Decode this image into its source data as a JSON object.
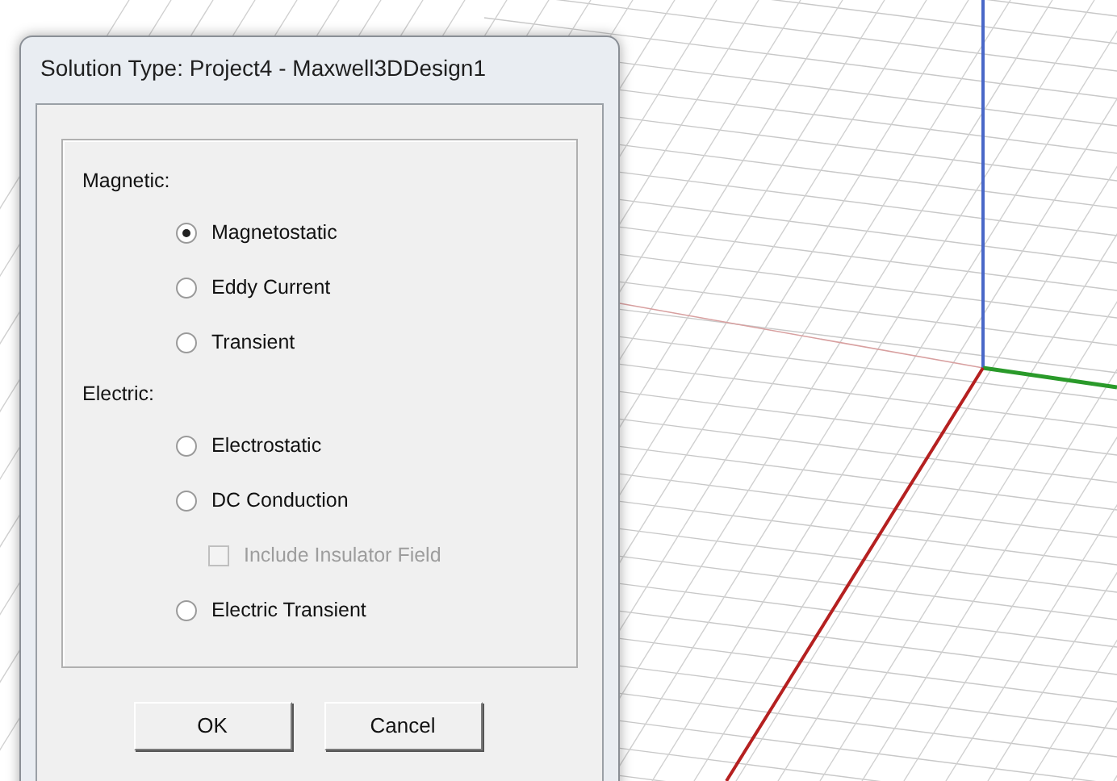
{
  "window": {
    "title": "Solution Type: Project4 - Maxwell3DDesign1"
  },
  "groups": [
    {
      "label": "Magnetic:",
      "options": [
        {
          "kind": "radio",
          "label": "Magnetostatic",
          "selected": true,
          "disabled": false
        },
        {
          "kind": "radio",
          "label": "Eddy Current",
          "selected": false,
          "disabled": false
        },
        {
          "kind": "radio",
          "label": "Transient",
          "selected": false,
          "disabled": false
        }
      ]
    },
    {
      "label": "Electric:",
      "options": [
        {
          "kind": "radio",
          "label": "Electrostatic",
          "selected": false,
          "disabled": false
        },
        {
          "kind": "radio",
          "label": "DC Conduction",
          "selected": false,
          "disabled": false
        },
        {
          "kind": "checkbox",
          "label": "Include Insulator Field",
          "checked": false,
          "disabled": true
        },
        {
          "kind": "radio",
          "label": "Electric Transient",
          "selected": false,
          "disabled": false
        }
      ]
    }
  ],
  "buttons": [
    "OK",
    "Cancel"
  ]
}
